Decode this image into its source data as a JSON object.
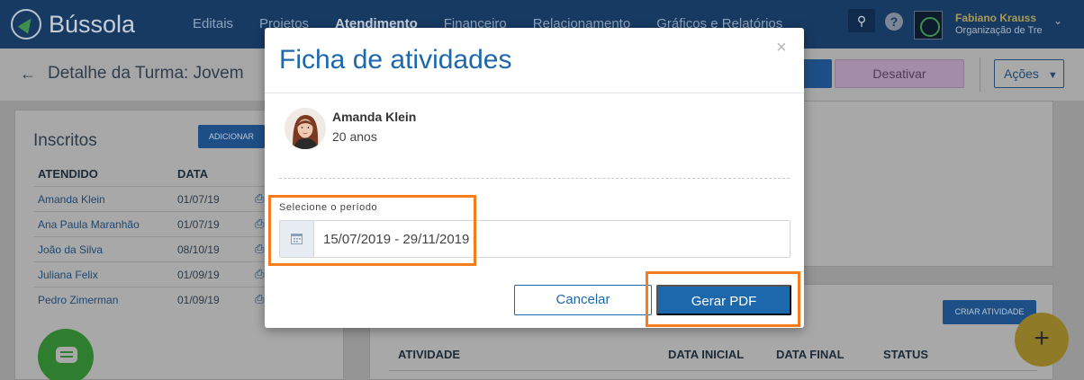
{
  "app": {
    "brand": "Bússola",
    "nav": [
      "Editais",
      "Projetos",
      "Atendimento",
      "Financeiro",
      "Relacionamento",
      "Gráficos e Relatórios"
    ],
    "active_nav": "Atendimento",
    "user": {
      "name": "Fabiano Krauss",
      "org": "Organização de Tre"
    }
  },
  "page": {
    "title": "Detalhe da Turma: Jovem",
    "buttons": {
      "desativar": "Desativar",
      "acoes": "Ações"
    }
  },
  "inscritos": {
    "title": "Inscritos",
    "add_label": "ADICIONAR",
    "columns": [
      "ATENDIDO",
      "DATA"
    ],
    "rows": [
      {
        "name": "Amanda Klein",
        "date": "01/07/19"
      },
      {
        "name": "Ana Paula Maranhão",
        "date": "01/07/19"
      },
      {
        "name": "João da Silva",
        "date": "08/10/19"
      },
      {
        "name": "Juliana Felix",
        "date": "01/09/19"
      },
      {
        "name": "Pedro Zimerman",
        "date": "01/09/19"
      }
    ]
  },
  "atividades": {
    "create_label": "CRIAR ATIVIDADE",
    "columns": [
      "ATIVIDADE",
      "DATA INICIAL",
      "DATA FINAL",
      "STATUS"
    ]
  },
  "modal": {
    "title": "Ficha de atividades",
    "close": "×",
    "person": {
      "name": "Amanda Klein",
      "age": "20 anos"
    },
    "period_label": "Selecione o período",
    "period_value": "15/07/2019 - 29/11/2019",
    "cancel_label": "Cancelar",
    "submit_label": "Gerar PDF"
  },
  "colors": {
    "primary": "#1d68ad",
    "highlight": "#f47d20",
    "topbar": "#173a63"
  },
  "icons": [
    "search-icon",
    "help-icon",
    "back-arrow-icon",
    "chevron-down-icon",
    "printer-icon",
    "calendar-icon",
    "close-icon",
    "chat-icon",
    "plus-icon"
  ]
}
